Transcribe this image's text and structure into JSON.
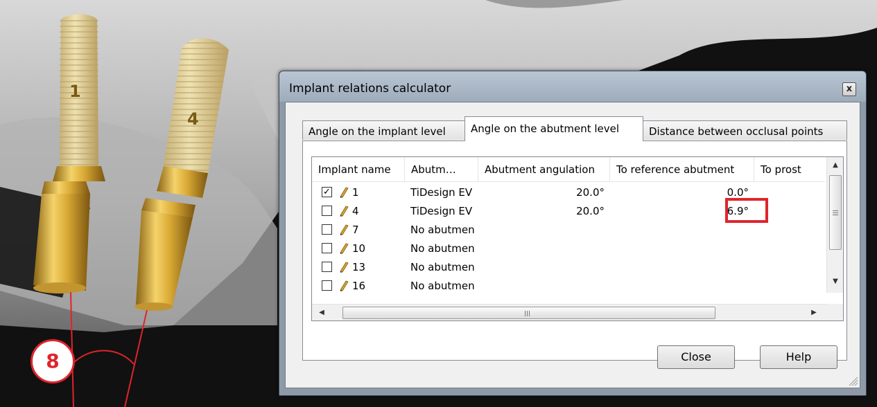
{
  "scene": {
    "implant_labels": [
      "1",
      "4"
    ],
    "annotation_badge": "8"
  },
  "dialog": {
    "title": "Implant relations calculator",
    "close_glyph": "x",
    "tabs": [
      {
        "label": "Angle on the implant level",
        "active": false
      },
      {
        "label": "Angle on the abutment level",
        "active": true
      },
      {
        "label": "Distance between occlusal points",
        "active": false
      }
    ],
    "table": {
      "columns": [
        "Implant name",
        "Abutm…",
        "Abutment angulation",
        "To reference abutment",
        "To prost"
      ],
      "rows": [
        {
          "checked": true,
          "name": "1",
          "abutment": "TiDesign EV",
          "angulation": "20.0°",
          "to_reference": "0.0°"
        },
        {
          "checked": false,
          "name": "4",
          "abutment": "TiDesign EV",
          "angulation": "20.0°",
          "to_reference": "6.9°"
        },
        {
          "checked": false,
          "name": "7",
          "abutment": "No abutmen",
          "angulation": "",
          "to_reference": ""
        },
        {
          "checked": false,
          "name": "10",
          "abutment": "No abutmen",
          "angulation": "",
          "to_reference": ""
        },
        {
          "checked": false,
          "name": "13",
          "abutment": "No abutmen",
          "angulation": "",
          "to_reference": ""
        },
        {
          "checked": false,
          "name": "16",
          "abutment": "No abutmen",
          "angulation": "",
          "to_reference": ""
        }
      ],
      "checkmark": "✓",
      "scroll_up": "▲",
      "scroll_down": "▼",
      "scroll_left": "◀",
      "scroll_right": "▶"
    },
    "buttons": {
      "close": "Close",
      "help": "Help"
    }
  },
  "colors": {
    "highlight": "#e0242b",
    "implant_gold": "#d9a934"
  }
}
